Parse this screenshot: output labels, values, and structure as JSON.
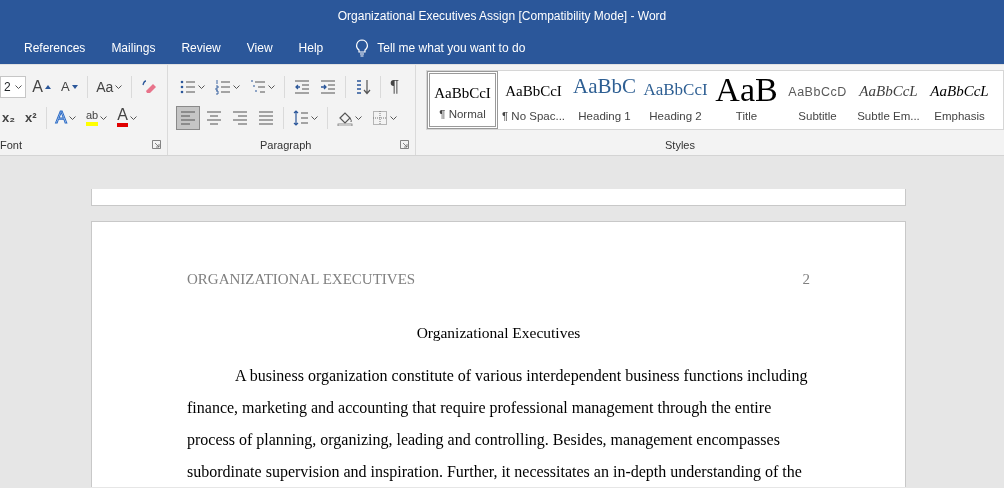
{
  "window": {
    "title": "Organizational Executives Assign [Compatibility Mode]  -  Word"
  },
  "tabs": [
    {
      "label": "References",
      "selected": false
    },
    {
      "label": "Mailings",
      "selected": false
    },
    {
      "label": "Review",
      "selected": false
    },
    {
      "label": "View",
      "selected": false
    },
    {
      "label": "Help",
      "selected": false
    }
  ],
  "tell_me": {
    "placeholder": "Tell me what you want to do"
  },
  "ribbon": {
    "font": {
      "label": "Font",
      "font_size": "2",
      "upper_tools": [
        {
          "kind": "grow",
          "glyph": "A"
        },
        {
          "kind": "shrink",
          "glyph": "A",
          "sep_after": true
        },
        {
          "kind": "case",
          "glyph": "Aa",
          "dropdown": true,
          "sep_after": true
        },
        {
          "kind": "clear"
        }
      ],
      "lower_tools": [
        {
          "kind": "subscript",
          "glyph": "x₂"
        },
        {
          "kind": "superscript",
          "glyph": "x²",
          "sep_after": true
        },
        {
          "kind": "effects",
          "glyph": "A",
          "dropdown": true
        },
        {
          "kind": "highlight",
          "glyph": "ab",
          "dropdown": true
        },
        {
          "kind": "fontcolor",
          "glyph": "A",
          "dropdown": true
        }
      ]
    },
    "paragraph": {
      "label": "Paragraph",
      "upper_tools": [
        {
          "kind": "bullets",
          "dropdown": true
        },
        {
          "kind": "numbering",
          "dropdown": true
        },
        {
          "kind": "multilevel",
          "dropdown": true,
          "sep_after": true
        },
        {
          "kind": "outdent"
        },
        {
          "kind": "indent",
          "sep_after": true
        },
        {
          "kind": "sort",
          "sep_after": true
        },
        {
          "kind": "pilcrow",
          "glyph": "¶"
        }
      ],
      "lower_tools": [
        {
          "kind": "align_left",
          "selected": true
        },
        {
          "kind": "align_center",
          "selected": false
        },
        {
          "kind": "align_right",
          "selected": false
        },
        {
          "kind": "justify",
          "selected": false,
          "sep_after": true
        },
        {
          "kind": "spacing",
          "dropdown": true,
          "sep_after": true
        },
        {
          "kind": "shading",
          "dropdown": true
        },
        {
          "kind": "borders",
          "dropdown": true
        }
      ]
    },
    "styles": {
      "label": "Styles",
      "items": [
        {
          "kind": "normal",
          "sample": "AaBbCcI",
          "name": "¶ Normal",
          "selected": true
        },
        {
          "kind": "normal",
          "sample": "AaBbCcI",
          "name": "¶ No Spac...",
          "selected": false
        },
        {
          "kind": "heading1",
          "sample": "AaBbC",
          "name": "Heading 1",
          "selected": false
        },
        {
          "kind": "heading2",
          "sample": "AaBbCcI",
          "name": "Heading 2",
          "selected": false
        },
        {
          "kind": "title",
          "sample": "AaB",
          "name": "Title",
          "selected": false
        },
        {
          "kind": "subtitle",
          "sample": "AaBbCcD",
          "name": "Subtitle",
          "selected": false
        },
        {
          "kind": "subtle",
          "sample": "AaBbCcL",
          "name": "Subtle Em...",
          "selected": false
        },
        {
          "kind": "emphasis",
          "sample": "AaBbCcL",
          "name": "Emphasis",
          "selected": false
        }
      ]
    }
  },
  "document": {
    "header": "ORGANIZATIONAL EXECUTIVES",
    "page_number": "2",
    "title": "Organizational Executives",
    "paragraphs": [
      "A business organization constitute of various interdependent business functions including finance, marketing and accounting that require professional management through the entire process of planning, organizing, leading and controlling. Besides, management encompasses subordinate supervision and inspiration. Further, it necessitates an in-depth understanding of the"
    ]
  }
}
